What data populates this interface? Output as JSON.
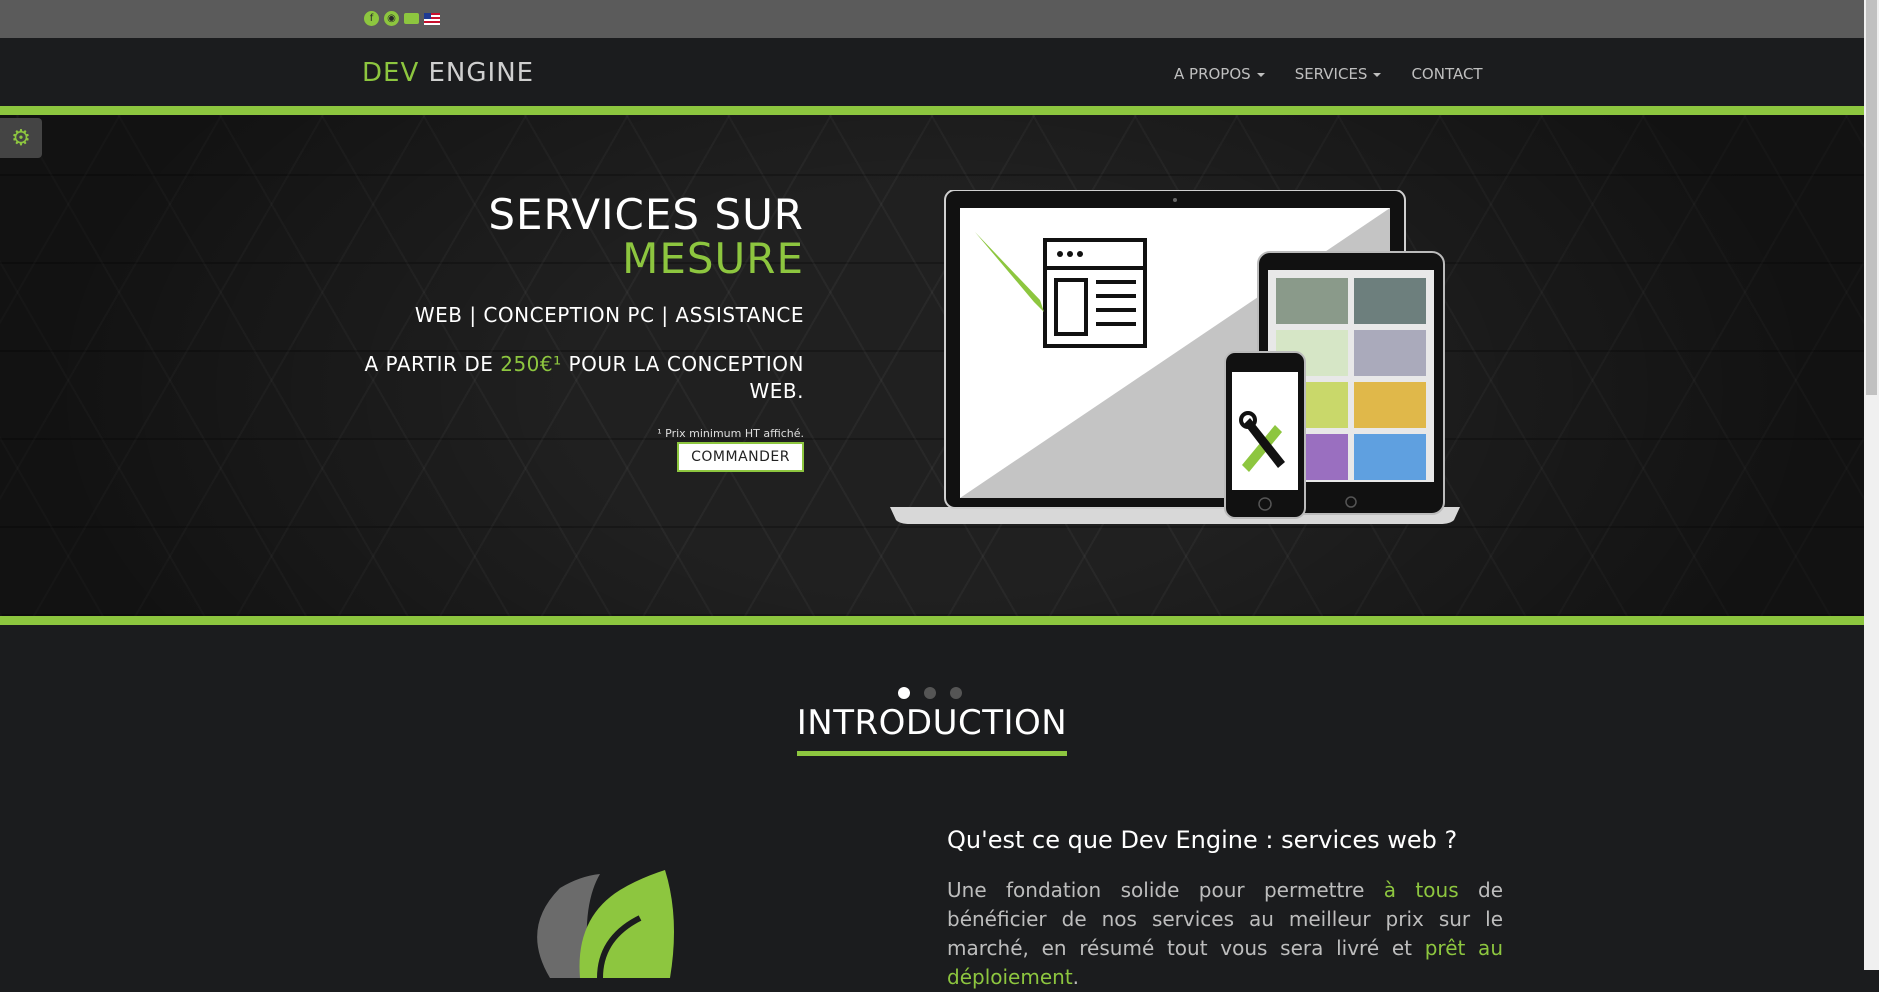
{
  "colors": {
    "accent": "#8dc63f",
    "background": "#1b1c1e",
    "topbar": "#5b5b5b"
  },
  "topbar": {
    "icons": [
      "facebook-icon",
      "discord-icon",
      "mail-icon",
      "us-flag-icon"
    ]
  },
  "brand": {
    "part1": "DEV",
    "part2": "ENGINE"
  },
  "nav": {
    "items": [
      {
        "label": "A PROPOS",
        "dropdown": true
      },
      {
        "label": "SERVICES",
        "dropdown": true
      },
      {
        "label": "CONTACT",
        "dropdown": false
      }
    ]
  },
  "hero": {
    "title_line1": "SERVICES SUR",
    "title_line2": "MESURE",
    "subtitle": "WEB | CONCEPTION PC | ASSISTANCE",
    "price_prefix": "A PARTIR DE ",
    "price": "250€",
    "price_sup": "¹",
    "price_suffix": " POUR LA CONCEPTION WEB.",
    "note": "¹ Prix minimum HT affiché.",
    "button": "COMMANDER",
    "slides": 3,
    "active_slide": 1
  },
  "intro": {
    "heading": "INTRODUCTION",
    "question": "Qu'est ce que Dev Engine : services web ?",
    "p1": "Une fondation solide pour permettre ",
    "p_hl1": "à tous",
    "p2": " de bénéficier de nos services au meilleur prix sur le marché, en résumé tout vous sera livré et ",
    "p_hl2": "prêt au déploiement",
    "p3": "."
  }
}
